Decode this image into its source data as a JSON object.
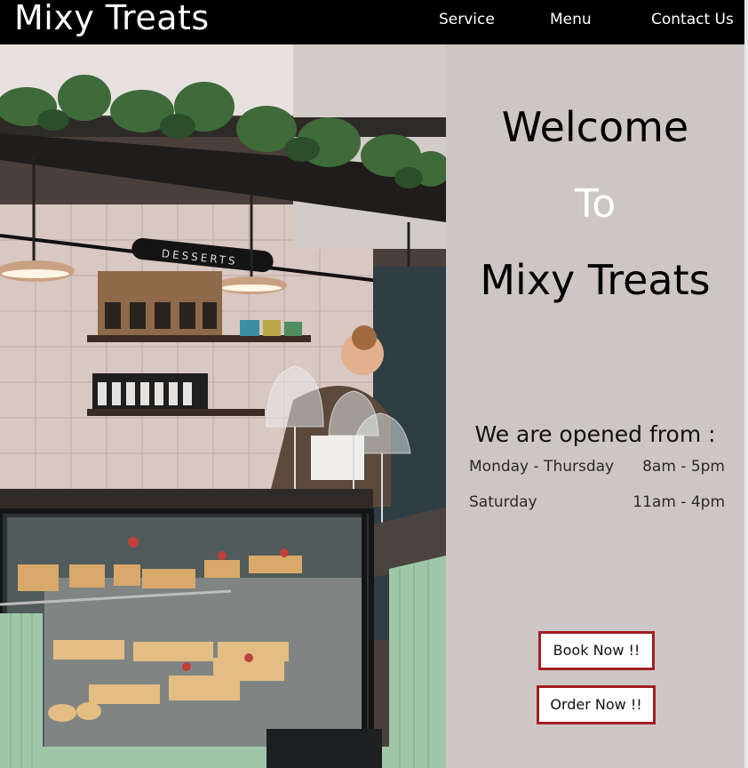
{
  "nav": {
    "brand": "Mixy Treats",
    "links": [
      "Service",
      "Menu",
      "Contact Us"
    ]
  },
  "hero": {
    "sign_text": "DESSERTS"
  },
  "welcome": {
    "line1": "Welcome",
    "line2": "To",
    "line3": "Mixy Treats"
  },
  "hours": {
    "title": "We are opened from :",
    "rows": [
      {
        "days": "Monday - Thursday",
        "time": "8am - 5pm"
      },
      {
        "days": "Saturday",
        "time": "11am - 4pm"
      }
    ]
  },
  "actions": {
    "book_label": "Book Now !!",
    "order_label": "Order Now !!"
  },
  "colors": {
    "nav_bg": "#000000",
    "panel_bg": "#cec6c5",
    "button_border": "#a31f24",
    "welcome_accent": "#ffffff"
  }
}
